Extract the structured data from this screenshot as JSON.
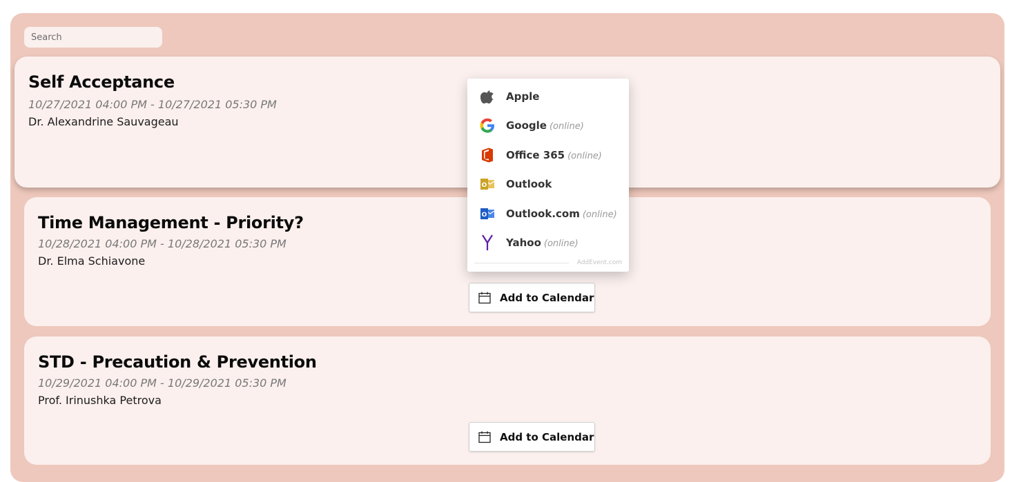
{
  "search": {
    "placeholder": "Search"
  },
  "events": [
    {
      "title": "Self Acceptance",
      "date": "10/27/2021 04:00 PM - 10/27/2021 05:30 PM",
      "host": "Dr. Alexandrine Sauvageau"
    },
    {
      "title": "Time Management - Priority?",
      "date": "10/28/2021 04:00 PM - 10/28/2021 05:30 PM",
      "host": "Dr. Elma Schiavone",
      "button_label": "Add to Calendar"
    },
    {
      "title": "STD - Precaution & Prevention",
      "date": "10/29/2021 04:00 PM - 10/29/2021 05:30 PM",
      "host": "Prof. Irinushka Petrova",
      "button_label": "Add to Calendar"
    }
  ],
  "calendar_dropdown": {
    "items": [
      {
        "label": "Apple",
        "note": "",
        "icon": "apple-icon"
      },
      {
        "label": "Google",
        "note": "(online)",
        "icon": "google-icon"
      },
      {
        "label": "Office 365",
        "note": "(online)",
        "icon": "office365-icon"
      },
      {
        "label": "Outlook",
        "note": "",
        "icon": "outlook-icon"
      },
      {
        "label": "Outlook.com",
        "note": "(online)",
        "icon": "outlookcom-icon"
      },
      {
        "label": "Yahoo",
        "note": "(online)",
        "icon": "yahoo-icon"
      }
    ],
    "footer": "AddEvent.com"
  },
  "colors": {
    "panel_bg": "#eec8bc",
    "card_bg": "#fbf0ee",
    "yahoo_purple": "#5f1fa8",
    "office_orange": "#d83b01",
    "outlook_gold": "#c9a227",
    "outlookcom_blue": "#1f5cc4"
  }
}
